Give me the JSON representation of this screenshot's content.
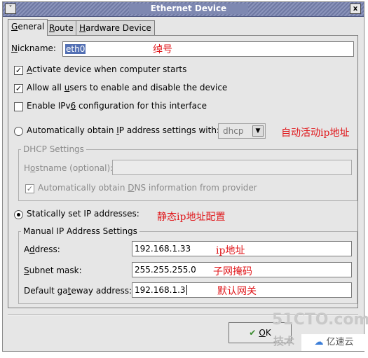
{
  "window": {
    "title": "Ethernet Device",
    "menu_glyph": "˅",
    "close_glyph": "x"
  },
  "tabs": [
    {
      "pre": "",
      "key": "G",
      "post": "eneral"
    },
    {
      "pre": "",
      "key": "R",
      "post": "oute"
    },
    {
      "pre": "",
      "key": "H",
      "post": "ardware Device"
    }
  ],
  "nickname": {
    "label_key": "N",
    "label_rest": "ickname:",
    "value": "eth0",
    "annotation": "绰号"
  },
  "checkboxes": {
    "activate": {
      "pre": "",
      "key": "A",
      "post": "ctivate device when computer starts",
      "checked": true
    },
    "allow_users": {
      "pre": "Allow all ",
      "key": "u",
      "post": "sers to enable and disable the device",
      "checked": true
    },
    "ipv6": {
      "pre": "Enable IPv",
      "key": "6",
      "post": " configuration for this interface",
      "checked": false
    }
  },
  "auto_ip": {
    "pre": "Automatically obtain ",
    "key": "I",
    "post": "P address settings with:",
    "protocol": "dhcp",
    "annotation": "自动活动ip地址"
  },
  "dhcp": {
    "group_title": "DHCP Settings",
    "hostname_pre": "H",
    "hostname_key": "o",
    "hostname_post": "stname (optional):",
    "dns_pre": "Automatically obtain ",
    "dns_key": "D",
    "dns_post": "NS information from provider",
    "dns_checked": true
  },
  "static": {
    "label": "Statically set IP addresses:",
    "annotation": "静态ip地址配置",
    "group_title": "Manual IP Address Settings",
    "address": {
      "pre": "A",
      "key": "d",
      "post": "dress:",
      "value": "192.168.1.33",
      "annotation": "ip地址"
    },
    "subnet": {
      "pre": "",
      "key": "S",
      "post": "ubnet mask:",
      "value": "255.255.255.0",
      "annotation": "子网掩码"
    },
    "gateway": {
      "pre": "Default ga",
      "key": "t",
      "post": "eway address:",
      "value": "192.168.1.3",
      "annotation": "默认网关"
    }
  },
  "ok_button": {
    "key": "O",
    "post": "K",
    "icon": "✔"
  },
  "watermarks": {
    "site": "51CTO.com",
    "blog_fragment": "技术",
    "brand": "亿速云",
    "brand_icon": "cloud-logo"
  },
  "colors": {
    "annotation": "#e0161a",
    "titlebar": "#7e88b1",
    "selection": "#5370b4"
  }
}
